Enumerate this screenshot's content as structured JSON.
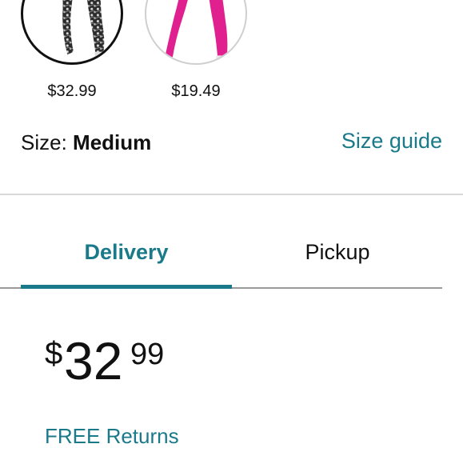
{
  "swatches": [
    {
      "price": "$32.99",
      "selected": true,
      "pattern": "black-white-floral"
    },
    {
      "price": "$19.49",
      "selected": false,
      "color": "#e0208f"
    }
  ],
  "size": {
    "label": "Size:",
    "value": "Medium",
    "guide_link": "Size guide"
  },
  "tabs": [
    {
      "label": "Delivery",
      "active": true
    },
    {
      "label": "Pickup",
      "active": false
    }
  ],
  "price": {
    "symbol": "$",
    "whole": "32",
    "fraction": "99"
  },
  "returns": {
    "label": "FREE Returns"
  },
  "colors": {
    "accent": "#1a7a8a",
    "text": "#111111",
    "swatch_pink": "#e0208f",
    "divider": "#d9d9d9"
  }
}
